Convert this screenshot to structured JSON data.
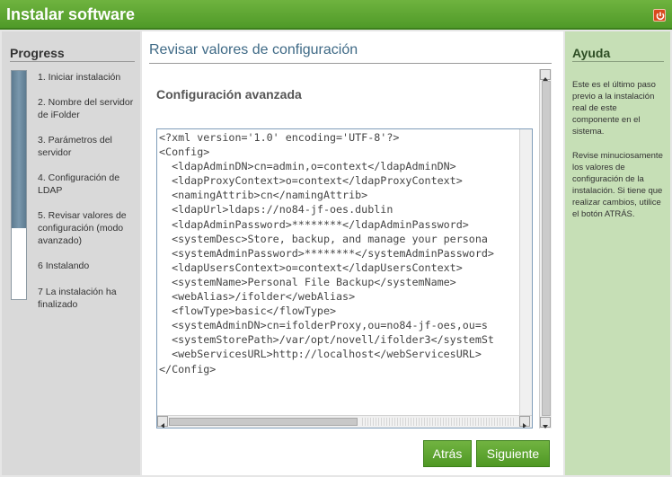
{
  "window": {
    "title": "Instalar software",
    "close_icon": "power-icon",
    "accent": "#5aa532"
  },
  "progress": {
    "heading": "Progress",
    "completed_fraction": 0.69,
    "steps": [
      {
        "label": "1. Iniciar instalación",
        "state": "done"
      },
      {
        "label": "2. Nombre del servidor de iFolder",
        "state": "done"
      },
      {
        "label": "3. Parámetros del servidor",
        "state": "done"
      },
      {
        "label": "4. Configuración de LDAP",
        "state": "done"
      },
      {
        "label": "5. Revisar valores de configuración (modo avanzado)",
        "state": "current"
      },
      {
        "label": "6 Instalando",
        "state": "pending"
      },
      {
        "label": "7 La instalación ha finalizado",
        "state": "pending"
      }
    ]
  },
  "main": {
    "section_title": "Revisar valores de configuración",
    "advanced_title": "Configuración avanzada",
    "config_lines": [
      "<?xml version='1.0' encoding='UTF-8'?>",
      "<Config>",
      "  <ldapAdminDN>cn=admin,o=context</ldapAdminDN>",
      "  <ldapProxyContext>o=context</ldapProxyContext>",
      "  <namingAttrib>cn</namingAttrib>",
      "  <ldapUrl>ldaps://no84-jf-oes.dublin",
      "  <ldapAdminPassword>********</ldapAdminPassword>",
      "  <systemDesc>Store, backup, and manage your persona",
      "  <systemAdminPassword>********</systemAdminPassword>",
      "  <ldapUsersContext>o=context</ldapUsersContext>",
      "  <systemName>Personal File Backup</systemName>",
      "  <webAlias>/ifolder</webAlias>",
      "  <flowType>basic</flowType>",
      "  <systemAdminDN>cn=ifolderProxy,ou=no84-jf-oes,ou=s",
      "  <systemStorePath>/var/opt/novell/ifolder3</systemSt",
      "  <webServicesURL>http://localhost</webServicesURL>",
      "</Config>"
    ],
    "back_label": "Atrás",
    "next_label": "Siguiente"
  },
  "help": {
    "heading": "Ayuda",
    "paragraphs": [
      "Este es el último paso previo a la instalación real de este componente en el sistema.",
      "Revise minuciosamente los valores de configuración de la instalación. Si tiene que realizar cambios, utilice el botón ATRÁS."
    ]
  }
}
